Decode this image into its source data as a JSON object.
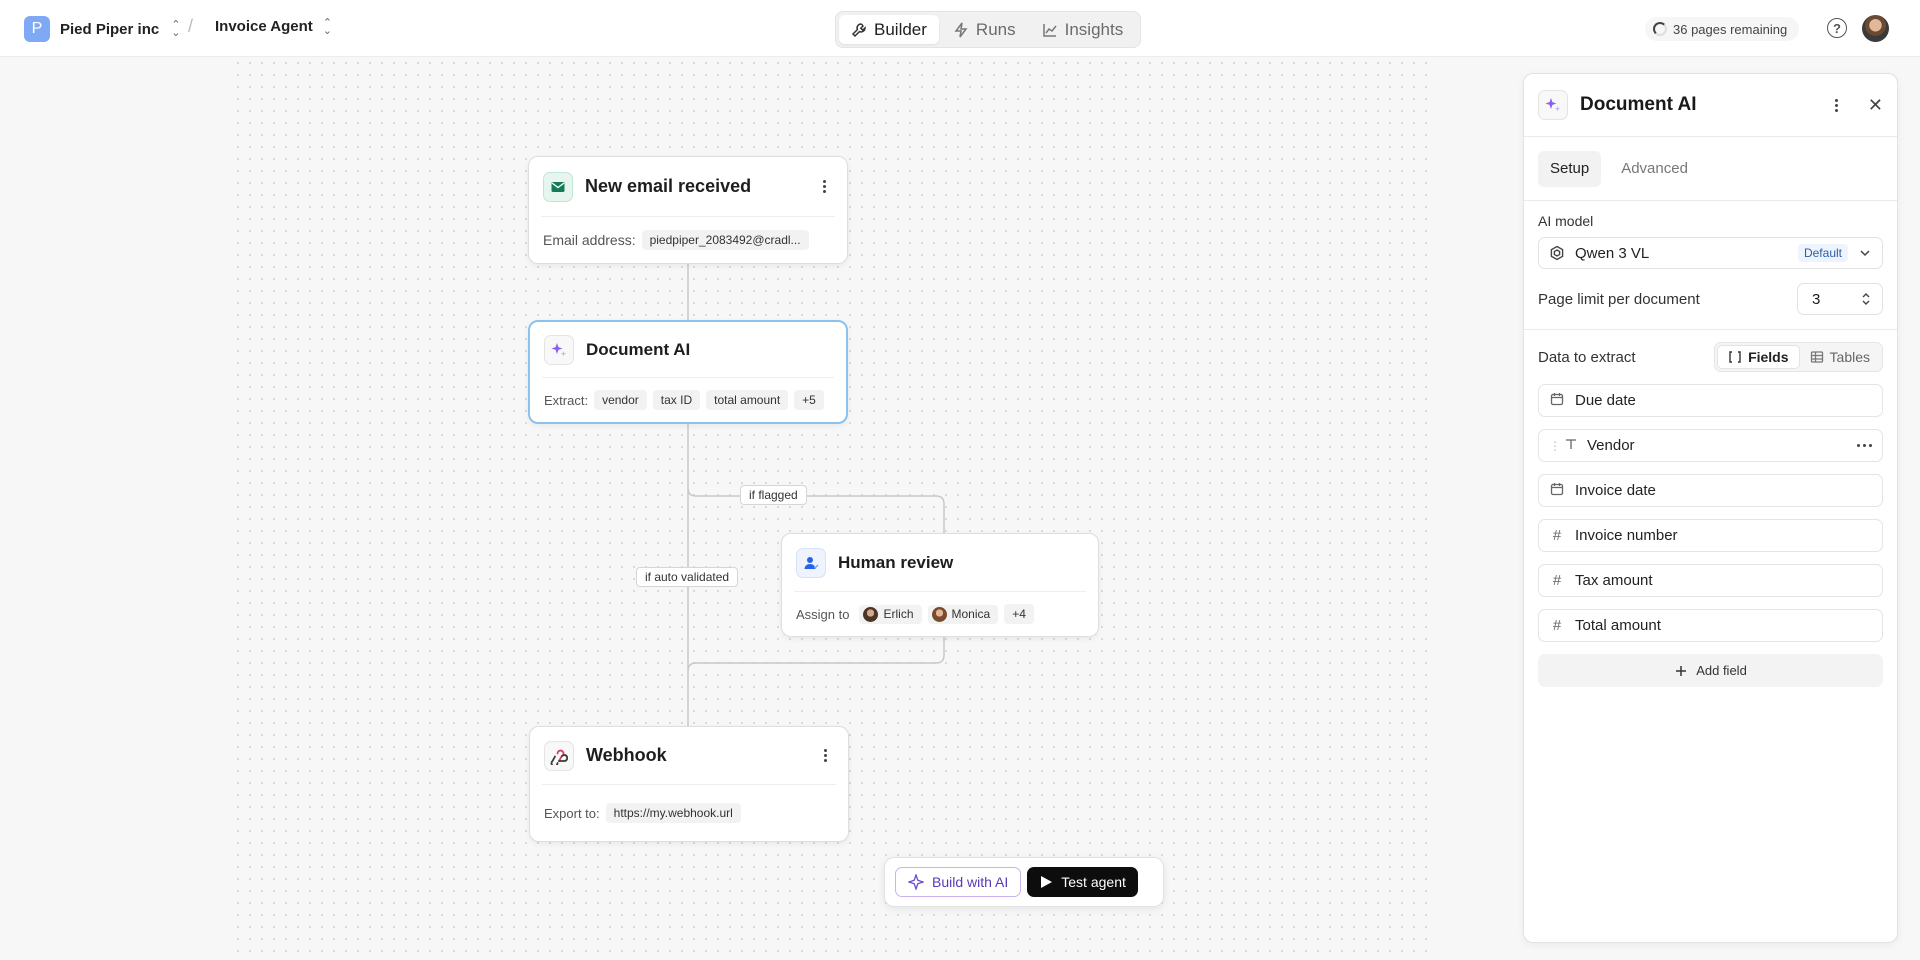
{
  "header": {
    "org_initial": "P",
    "org_name": "Pied Piper inc",
    "separator": "/",
    "agent_name": "Invoice Agent",
    "tabs": [
      {
        "label": "Builder",
        "icon": "wrench-icon",
        "active": true
      },
      {
        "label": "Runs",
        "icon": "bolt-icon",
        "active": false
      },
      {
        "label": "Insights",
        "icon": "chart-line-icon",
        "active": false
      }
    ],
    "pages_remaining": "36 pages remaining",
    "help_glyph": "?"
  },
  "nodes": {
    "email": {
      "title": "New email received",
      "body_label": "Email address:",
      "address": "piedpiper_2083492@cradl..."
    },
    "doc_ai": {
      "title": "Document AI",
      "body_label": "Extract:",
      "chips": [
        "vendor",
        "tax ID",
        "total amount",
        "+5"
      ]
    },
    "human_review": {
      "title": "Human review",
      "body_label": "Assign to",
      "assignees": [
        "Erlich",
        "Monica"
      ],
      "more": "+4"
    },
    "webhook": {
      "title": "Webhook",
      "body_label": "Export to:",
      "url": "https://my.webhook.url"
    }
  },
  "edge_labels": {
    "flagged": "if flagged",
    "auto_validated": "if auto validated"
  },
  "actions": {
    "build_ai": "Build with AI",
    "test_agent": "Test agent"
  },
  "panel": {
    "title": "Document AI",
    "tabs": [
      {
        "label": "Setup",
        "active": true
      },
      {
        "label": "Advanced",
        "active": false
      }
    ],
    "ai_model_label": "AI model",
    "ai_model_value": "Qwen 3 VL",
    "ai_model_badge": "Default",
    "page_limit_label": "Page limit per document",
    "page_limit_value": "3",
    "extract_label": "Data to extract",
    "extract_modes": [
      {
        "label": "Fields",
        "active": true
      },
      {
        "label": "Tables",
        "active": false
      }
    ],
    "fields": [
      {
        "name": "Due date",
        "icon": "calendar-icon"
      },
      {
        "name": "Vendor",
        "icon": "text-icon"
      },
      {
        "name": "Invoice date",
        "icon": "calendar-icon"
      },
      {
        "name": "Invoice number",
        "icon": "hash-icon"
      },
      {
        "name": "Tax amount",
        "icon": "hash-icon"
      },
      {
        "name": "Total amount",
        "icon": "hash-icon"
      }
    ],
    "add_field": "Add field"
  },
  "colors": {
    "selected_border": "#8cc3ee",
    "ai_accent": "#8b5cf6",
    "email_icon": "#137a5a",
    "review_icon": "#2563eb",
    "webhook_icon": "#d93b5a"
  }
}
